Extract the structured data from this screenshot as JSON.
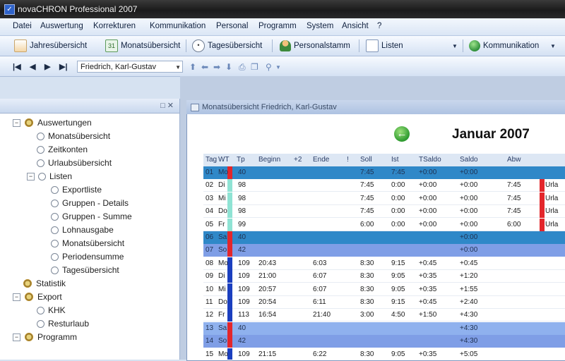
{
  "window": {
    "title": "novaCHRON Professional 2007"
  },
  "menu": [
    "Datei",
    "Auswertung",
    "Korrekturen",
    "Kommunikation",
    "Personal",
    "Programm",
    "System",
    "Ansicht",
    "?"
  ],
  "toolbar1": {
    "jahres": "Jahresübersicht",
    "monats": "Monatsübersicht",
    "tages": "Tagesübersicht",
    "personal": "Personalstamm",
    "listen": "Listen",
    "kommunikation": "Kommunikation"
  },
  "toolbar2": {
    "person": "Friedrich, Karl-Gustav"
  },
  "tree": [
    {
      "label": "Auswertungen",
      "level": 0,
      "toggle": "−",
      "icon": "gear"
    },
    {
      "label": "Monatsübersicht",
      "level": 1,
      "icon": "leaf"
    },
    {
      "label": "Zeitkonten",
      "level": 1,
      "icon": "leaf"
    },
    {
      "label": "Urlaubsübersicht",
      "level": 1,
      "icon": "leaf"
    },
    {
      "label": "Listen",
      "level": 1,
      "toggle": "−",
      "icon": "leaf"
    },
    {
      "label": "Exportliste",
      "level": 2,
      "icon": "leaf"
    },
    {
      "label": "Gruppen - Details",
      "level": 2,
      "icon": "leaf"
    },
    {
      "label": "Gruppen - Summe",
      "level": 2,
      "icon": "leaf"
    },
    {
      "label": "Lohnausgabe",
      "level": 2,
      "icon": "leaf"
    },
    {
      "label": "Monatsübersicht",
      "level": 2,
      "icon": "leaf"
    },
    {
      "label": "Periodensumme",
      "level": 2,
      "icon": "leaf"
    },
    {
      "label": "Tagesübersicht",
      "level": 2,
      "icon": "leaf"
    },
    {
      "label": "Statistik",
      "level": 0,
      "icon": "gear"
    },
    {
      "label": "Export",
      "level": 0,
      "toggle": "−",
      "icon": "gear"
    },
    {
      "label": "KHK",
      "level": 1,
      "icon": "leaf"
    },
    {
      "label": "Resturlaub",
      "level": 1,
      "icon": "leaf"
    },
    {
      "label": "Programm",
      "level": 0,
      "toggle": "−",
      "icon": "gear"
    }
  ],
  "document": {
    "title": "Monatsübersicht Friedrich, Karl-Gustav",
    "month": "Januar 2007"
  },
  "table": {
    "columns": [
      "Tag",
      "WT",
      "Tp",
      "Beginn",
      "+2",
      "Ende",
      "!",
      "Soll",
      "Ist",
      "TSaldo",
      "Saldo",
      "Abw"
    ],
    "rows": [
      {
        "style": "blue",
        "wtcolor": "#e3262b",
        "cells": [
          "01",
          "Mo",
          "40",
          "",
          "",
          "",
          "",
          "7:45",
          "7:45",
          "+0:00",
          "+0:00",
          "",
          ""
        ]
      },
      {
        "style": "white",
        "wtcolor": "#8fe3d4",
        "cells": [
          "02",
          "Di",
          "98",
          "",
          "",
          "",
          "",
          "7:45",
          "0:00",
          "+0:00",
          "+0:00",
          "7:45",
          "Urla"
        ]
      },
      {
        "style": "white",
        "wtcolor": "#8fe3d4",
        "cells": [
          "03",
          "Mi",
          "98",
          "",
          "",
          "",
          "",
          "7:45",
          "0:00",
          "+0:00",
          "+0:00",
          "7:45",
          "Urla"
        ]
      },
      {
        "style": "white",
        "wtcolor": "#8fe3d4",
        "cells": [
          "04",
          "Do",
          "98",
          "",
          "",
          "",
          "",
          "7:45",
          "0:00",
          "+0:00",
          "+0:00",
          "7:45",
          "Urla"
        ]
      },
      {
        "style": "white",
        "wtcolor": "#8fe3d4",
        "cells": [
          "05",
          "Fr",
          "99",
          "",
          "",
          "",
          "",
          "6:00",
          "0:00",
          "+0:00",
          "+0:00",
          "6:00",
          "Urla"
        ]
      },
      {
        "style": "blue",
        "wtcolor": "#e3262b",
        "cells": [
          "06",
          "Sa",
          "40",
          "",
          "",
          "",
          "",
          "",
          "",
          "",
          "+0:00",
          "",
          ""
        ]
      },
      {
        "style": "purple",
        "wtcolor": "#e3262b",
        "cells": [
          "07",
          "So",
          "42",
          "",
          "",
          "",
          "",
          "",
          "",
          "",
          "+0:00",
          "",
          ""
        ]
      },
      {
        "style": "white",
        "wtcolor": "#1b3fbf",
        "cells": [
          "08",
          "Mo",
          "109",
          "20:43",
          "",
          "6:03",
          "",
          "8:30",
          "9:15",
          "+0:45",
          "+0:45",
          "",
          ""
        ]
      },
      {
        "style": "white",
        "wtcolor": "#1b3fbf",
        "cells": [
          "09",
          "Di",
          "109",
          "21:00",
          "",
          "6:07",
          "",
          "8:30",
          "9:05",
          "+0:35",
          "+1:20",
          "",
          ""
        ]
      },
      {
        "style": "white",
        "wtcolor": "#1b3fbf",
        "cells": [
          "10",
          "Mi",
          "109",
          "20:57",
          "",
          "6:07",
          "",
          "8:30",
          "9:05",
          "+0:35",
          "+1:55",
          "",
          ""
        ]
      },
      {
        "style": "white",
        "wtcolor": "#1b3fbf",
        "cells": [
          "11",
          "Do",
          "109",
          "20:54",
          "",
          "6:11",
          "",
          "8:30",
          "9:15",
          "+0:45",
          "+2:40",
          "",
          ""
        ]
      },
      {
        "style": "white",
        "wtcolor": "#1b3fbf",
        "cells": [
          "12",
          "Fr",
          "113",
          "16:54",
          "",
          "21:40",
          "",
          "3:00",
          "4:50",
          "+1:50",
          "+4:30",
          "",
          ""
        ]
      },
      {
        "style": "lav",
        "wtcolor": "#e3262b",
        "cells": [
          "13",
          "Sa",
          "40",
          "",
          "",
          "",
          "",
          "",
          "",
          "",
          "+4:30",
          "",
          ""
        ]
      },
      {
        "style": "purple",
        "wtcolor": "#e3262b",
        "cells": [
          "14",
          "So",
          "42",
          "",
          "",
          "",
          "",
          "",
          "",
          "",
          "+4:30",
          "",
          ""
        ]
      },
      {
        "style": "white",
        "wtcolor": "#1b3fbf",
        "cells": [
          "15",
          "Mo",
          "109",
          "21:15",
          "",
          "6:22",
          "",
          "8:30",
          "9:05",
          "+0:35",
          "+5:05",
          "",
          ""
        ]
      }
    ]
  }
}
